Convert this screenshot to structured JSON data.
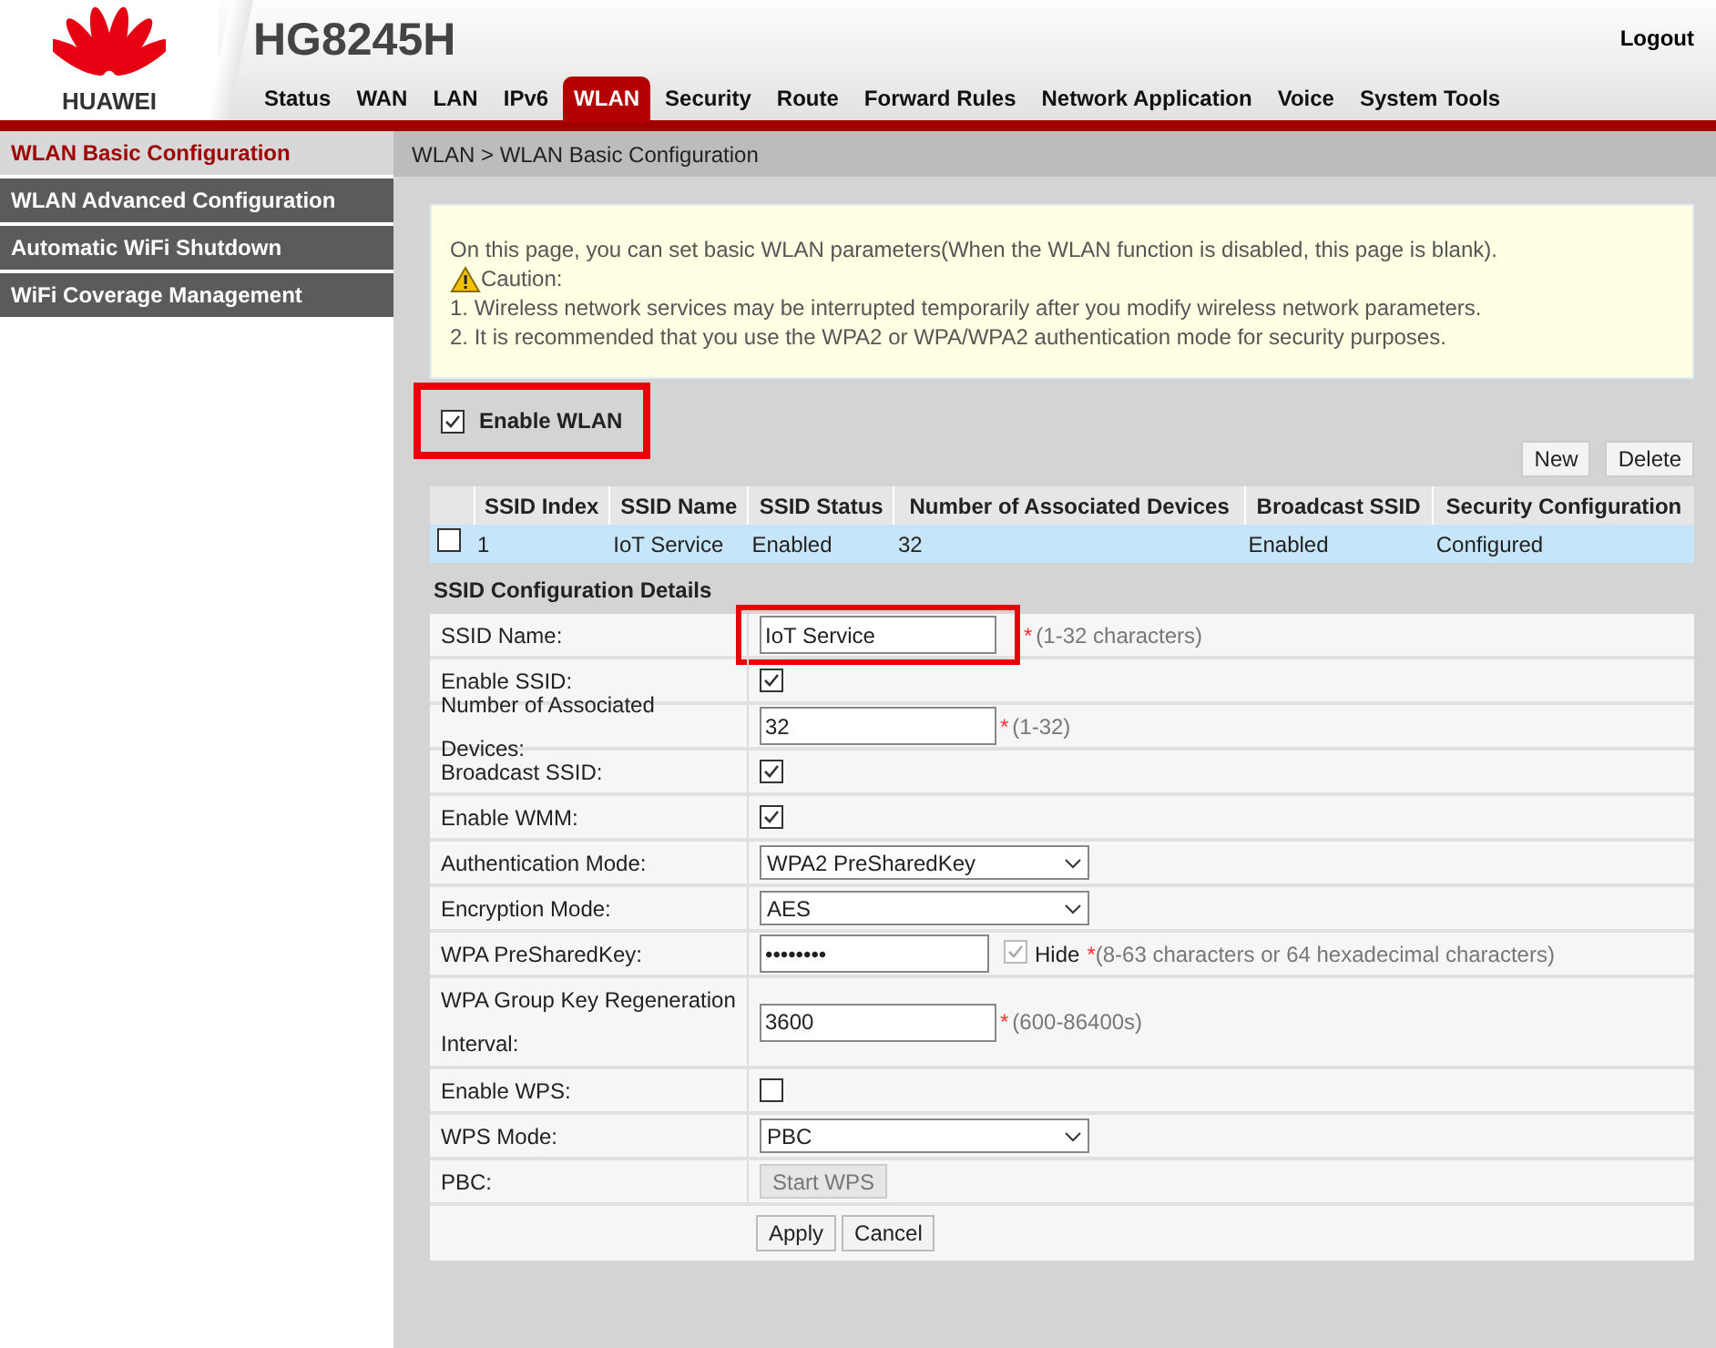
{
  "header": {
    "brand": "HUAWEI",
    "model": "HG8245H",
    "logout": "Logout"
  },
  "nav": [
    {
      "label": "Status",
      "selected": false
    },
    {
      "label": "WAN",
      "selected": false
    },
    {
      "label": "LAN",
      "selected": false
    },
    {
      "label": "IPv6",
      "selected": false
    },
    {
      "label": "WLAN",
      "selected": true
    },
    {
      "label": "Security",
      "selected": false
    },
    {
      "label": "Route",
      "selected": false
    },
    {
      "label": "Forward Rules",
      "selected": false
    },
    {
      "label": "Network Application",
      "selected": false
    },
    {
      "label": "Voice",
      "selected": false
    },
    {
      "label": "System Tools",
      "selected": false
    }
  ],
  "sidebar": {
    "items": [
      {
        "label": "WLAN Basic Configuration",
        "selected": true
      },
      {
        "label": "WLAN Advanced Configuration",
        "selected": false
      },
      {
        "label": "Automatic WiFi Shutdown",
        "selected": false
      },
      {
        "label": "WiFi Coverage Management",
        "selected": false
      }
    ]
  },
  "breadcrumb": "WLAN > WLAN Basic Configuration",
  "notice": {
    "intro": "On this page, you can set basic WLAN parameters(When the WLAN function is disabled, this page is blank).",
    "caution": "Caution:",
    "points": [
      "1. Wireless network services may be interrupted temporarily after you modify wireless network parameters.",
      "2. It is recommended that you use the WPA2 or WPA/WPA2 authentication mode for security purposes."
    ]
  },
  "enable_wlan": {
    "label": "Enable WLAN",
    "checked": true,
    "highlighted": true
  },
  "table_buttons": [
    "New",
    "Delete"
  ],
  "table": {
    "columns": [
      "SSID Index",
      "SSID Name",
      "SSID Status",
      "Number of Associated Devices",
      "Broadcast SSID",
      "Security Configuration"
    ],
    "rows": [
      {
        "checked": false,
        "selected": true,
        "cells": [
          "1",
          "IoT Service",
          "Enabled",
          "32",
          "Enabled",
          "Configured"
        ]
      }
    ]
  },
  "details": {
    "title": "SSID Configuration Details",
    "rows": [
      {
        "kind": "text",
        "label": "SSID Name:",
        "value": "IoT Service",
        "required": "*",
        "hint": "(1-32 characters)",
        "highlighted": true
      },
      {
        "kind": "checkbox",
        "label": "Enable SSID:",
        "checked": true
      },
      {
        "kind": "text",
        "label": "Number of Associated Devices:",
        "value": "32",
        "required": "*",
        "hint": "(1-32)",
        "highlighted": false
      },
      {
        "kind": "checkbox",
        "label": "Broadcast SSID:",
        "checked": true
      },
      {
        "kind": "checkbox",
        "label": "Enable WMM:",
        "checked": true
      },
      {
        "kind": "select",
        "label": "Authentication Mode:",
        "value": "WPA2 PreSharedKey"
      },
      {
        "kind": "select",
        "label": "Encryption Mode:",
        "value": "AES"
      },
      {
        "kind": "password",
        "label": "WPA PreSharedKey:",
        "value": "••••••••",
        "hide_label": "Hide",
        "hide_checked": true,
        "required": "*",
        "hint": "(8-63 characters or 64 hexadecimal characters)"
      },
      {
        "kind": "text",
        "label": "WPA Group Key Regeneration Interval:",
        "value": "3600",
        "required": "*",
        "hint": "(600-86400s)",
        "highlighted": false
      },
      {
        "kind": "checkbox",
        "label": "Enable WPS:",
        "checked": false
      },
      {
        "kind": "select",
        "label": "WPS Mode:",
        "value": "PBC"
      },
      {
        "kind": "button",
        "label": "PBC:",
        "button": "Start WPS",
        "disabled": true
      }
    ],
    "buttons": [
      "Apply",
      "Cancel"
    ]
  }
}
